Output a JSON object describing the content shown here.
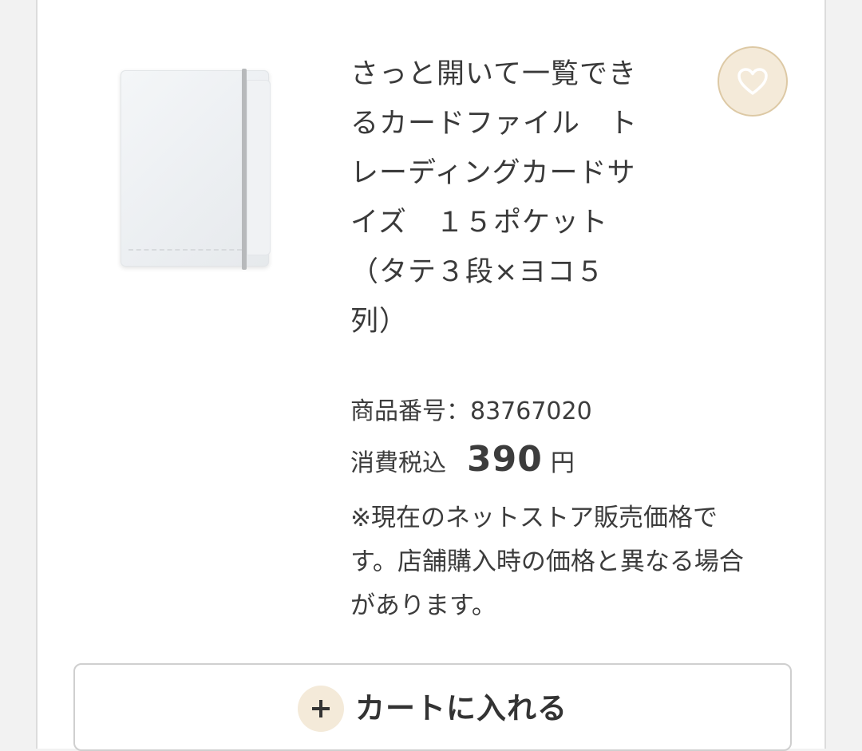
{
  "product": {
    "title_lines": [
      "さっと開いて一覧でき",
      "るカードファイル　ト",
      "レーディングカードサ",
      "イズ　１５ポケット",
      "（タテ３段×ヨコ５",
      "列）"
    ],
    "item_number": "商品番号：83767020",
    "tax_label": "消費税込",
    "price": "390",
    "currency": "円",
    "note_lines": [
      "※現在のネットストア販売価格で",
      "す。店舗購入時の価格と異なる場合",
      "があります。"
    ]
  },
  "favorite": {
    "icon": "heart-icon"
  },
  "cart_button": {
    "icon": "plus-icon",
    "label": "カートに入れる"
  },
  "colors": {
    "accent_bg": "#f4ead9",
    "accent_border": "#ddc9a5",
    "text": "#3c3c3c"
  }
}
